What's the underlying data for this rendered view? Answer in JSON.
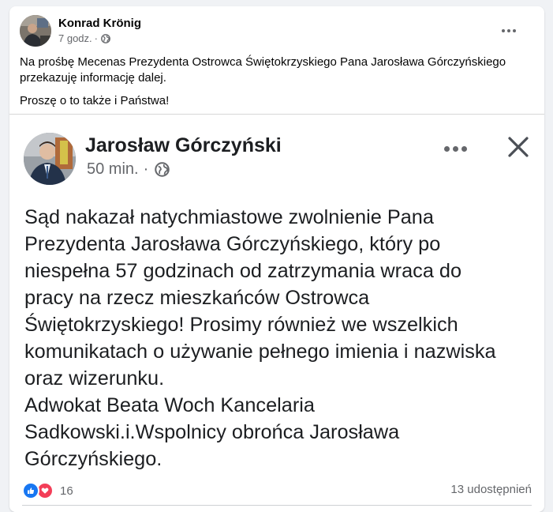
{
  "post": {
    "author": "Konrad Krönig",
    "time": "7 godz.",
    "separator": "·",
    "paragraphs": [
      "Na prośbę Mecenas Prezydenta Ostrowca Świętokrzyskiego Pana Jarosława Górczyńskiego przekazuję informację dalej.",
      "Proszę o to także i Państwa!"
    ]
  },
  "shared": {
    "author": "Jarosław Górczyński",
    "time": "50 min.",
    "separator": "·",
    "lines": [
      "Sąd nakazał natychmiastowe zwolnienie Pana",
      "Prezydenta Jarosława Górczyńskiego, który po",
      "niespełna 57 godzinach od zatrzymania wraca do",
      "pracy na rzecz mieszkańców Ostrowca",
      "Świętokrzyskiego! Prosimy również we wszelkich",
      "komunikatach o używanie pełnego imienia i nazwiska",
      "oraz wizerunku.",
      "Adwokat Beata Woch Kancelaria",
      "Sadkowski.i.Wspolnicy obrońca Jarosława",
      "Górczyńskiego."
    ]
  },
  "footer": {
    "reaction_count": "16",
    "shares": "13 udostępnień"
  },
  "icons": {
    "like": "like-icon",
    "love": "love-icon",
    "globe": "globe-icon",
    "more": "more-options-icon",
    "close": "close-icon"
  },
  "colors": {
    "like": "#1877f2",
    "love": "#f33e58",
    "secondary_text": "#65676b"
  }
}
